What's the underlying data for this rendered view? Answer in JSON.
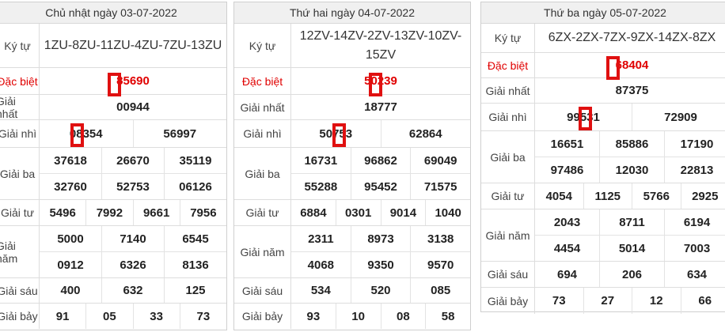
{
  "panels": [
    {
      "title": "Chủ nhật ngày 03-07-2022",
      "code_label": "Ký tự",
      "code": "1ZU-8ZU-11ZU-4ZU-7ZU-13ZU",
      "prizes": [
        {
          "label": "Đặc biệt",
          "rows": [
            [
              "85690"
            ]
          ]
        },
        {
          "label": "Giải nhất",
          "rows": [
            [
              "00944"
            ]
          ]
        },
        {
          "label": "Giải nhì",
          "rows": [
            [
              "08354",
              "56997"
            ]
          ]
        },
        {
          "label": "Giải ba",
          "rows": [
            [
              "37618",
              "26670",
              "35119"
            ],
            [
              "32760",
              "52753",
              "06126"
            ]
          ]
        },
        {
          "label": "Giải tư",
          "rows": [
            [
              "5496",
              "7992",
              "9661",
              "7956"
            ]
          ]
        },
        {
          "label": "Giải năm",
          "rows": [
            [
              "5000",
              "7140",
              "6545"
            ],
            [
              "0912",
              "6326",
              "8136"
            ]
          ]
        },
        {
          "label": "Giải sáu",
          "rows": [
            [
              "400",
              "632",
              "125"
            ]
          ]
        },
        {
          "label": "Giải bảy",
          "rows": [
            [
              "91",
              "05",
              "33",
              "73"
            ]
          ]
        }
      ]
    },
    {
      "title": "Thứ hai ngày 04-07-2022",
      "code_label": "Ký tự",
      "code": "12ZV-14ZV-2ZV-13ZV-10ZV-15ZV",
      "prizes": [
        {
          "label": "Đặc biệt",
          "rows": [
            [
              "50239"
            ]
          ]
        },
        {
          "label": "Giải nhất",
          "rows": [
            [
              "18777"
            ]
          ]
        },
        {
          "label": "Giải nhì",
          "rows": [
            [
              "50753",
              "62864"
            ]
          ]
        },
        {
          "label": "Giải ba",
          "rows": [
            [
              "16731",
              "96862",
              "69049"
            ],
            [
              "55288",
              "95452",
              "71575"
            ]
          ]
        },
        {
          "label": "Giải tư",
          "rows": [
            [
              "6884",
              "0301",
              "9014",
              "1040"
            ]
          ]
        },
        {
          "label": "Giải năm",
          "rows": [
            [
              "2311",
              "8973",
              "3138"
            ],
            [
              "4068",
              "9350",
              "9570"
            ]
          ]
        },
        {
          "label": "Giải sáu",
          "rows": [
            [
              "534",
              "520",
              "085"
            ]
          ]
        },
        {
          "label": "Giải bảy",
          "rows": [
            [
              "93",
              "10",
              "08",
              "58"
            ]
          ]
        }
      ]
    },
    {
      "title": "Thứ ba ngày 05-07-2022",
      "code_label": "Ký tự",
      "code": "6ZX-2ZX-7ZX-9ZX-14ZX-8ZX",
      "prizes": [
        {
          "label": "Đặc biệt",
          "rows": [
            [
              "68404"
            ]
          ]
        },
        {
          "label": "Giải nhất",
          "rows": [
            [
              "87375"
            ]
          ]
        },
        {
          "label": "Giải nhì",
          "rows": [
            [
              "99531",
              "72909"
            ]
          ]
        },
        {
          "label": "Giải ba",
          "rows": [
            [
              "16651",
              "85886",
              "17190"
            ],
            [
              "97486",
              "12030",
              "22813"
            ]
          ]
        },
        {
          "label": "Giải tư",
          "rows": [
            [
              "4054",
              "1125",
              "5766",
              "2925"
            ]
          ]
        },
        {
          "label": "Giải năm",
          "rows": [
            [
              "2043",
              "8711",
              "6194"
            ],
            [
              "4454",
              "5014",
              "7003"
            ]
          ]
        },
        {
          "label": "Giải sáu",
          "rows": [
            [
              "694",
              "206",
              "634"
            ]
          ]
        },
        {
          "label": "Giải bảy",
          "rows": [
            [
              "73",
              "27",
              "12",
              "66"
            ]
          ]
        }
      ]
    }
  ],
  "colors": {
    "special_prize": "#e00000",
    "highlight_box": "#e01010",
    "header_bg": "#f0f0f0"
  }
}
